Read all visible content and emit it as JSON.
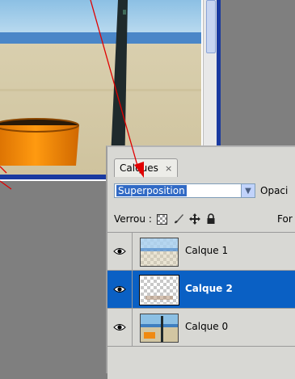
{
  "layers_panel": {
    "tab_label": "Calques",
    "tab_close": "×",
    "blend_mode": "Superposition",
    "opacity_label": "Opaci",
    "lock_label": "Verrou :",
    "fill_label": "For",
    "layers": [
      {
        "name": "Calque 1",
        "selected": false,
        "visible": true
      },
      {
        "name": "Calque 2",
        "selected": true,
        "visible": true
      },
      {
        "name": "Calque 0",
        "selected": false,
        "visible": true
      }
    ]
  },
  "colors": {
    "selection": "#0a60c4",
    "annotation_arrow": "#e00000",
    "document_border": "#1a3aa0"
  }
}
